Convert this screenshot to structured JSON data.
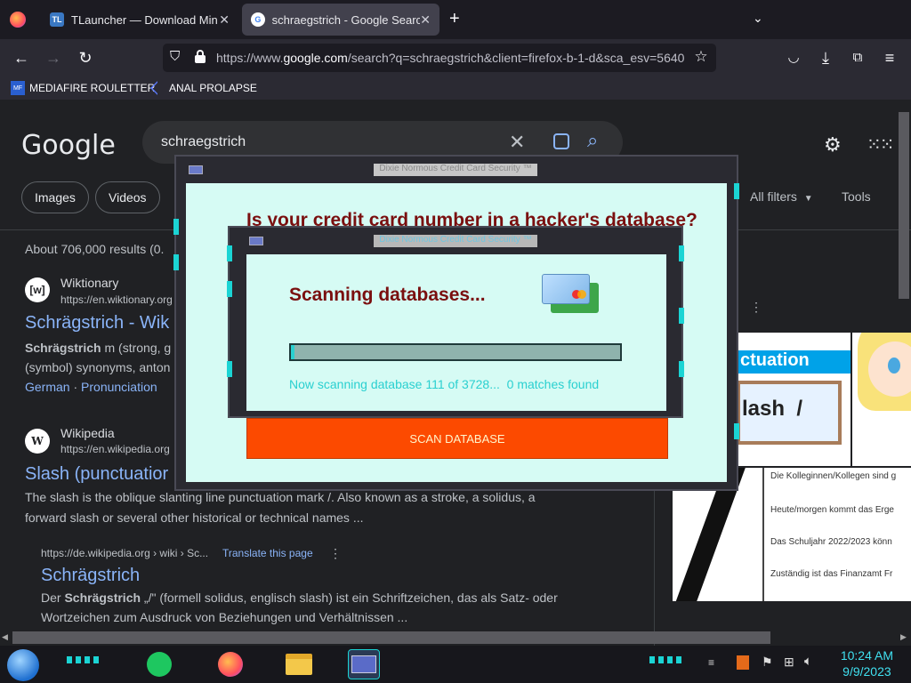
{
  "browser": {
    "tabs": [
      {
        "favicon": "TL",
        "title": "TLauncher — Download Minec"
      },
      {
        "favicon": "G",
        "title": "schraegstrich - Google Search"
      }
    ],
    "new_tab": "+",
    "url_prefix": "https://www.",
    "url_domain": "google.com",
    "url_rest": "/search?q=schraegstrich&client=firefox-b-1-d&sca_esv=5640",
    "bookmarks": [
      {
        "icon": "MF",
        "label": "MEDIAFIRE ROULETTER"
      },
      {
        "icon": "flag",
        "label": "ANAL PROLAPSE"
      }
    ]
  },
  "google": {
    "logo": "Google",
    "query": "schraegstrich",
    "chips": [
      "Images",
      "Videos"
    ],
    "all_filters": "All filters",
    "tools": "Tools",
    "stats": "About 706,000 results (0.",
    "results": [
      {
        "favicon": "[w]",
        "site": "Wiktionary",
        "url": "https://en.wiktionary.org",
        "title": "Schrägstrich - Wik",
        "snippet_bold": "Schrägstrich",
        "snippet1": " m (strong, g",
        "snippet2": "(symbol) synonyms, anton",
        "links": [
          "German",
          "Pronunciation"
        ]
      },
      {
        "favicon": "W",
        "site": "Wikipedia",
        "url": "https://en.wikipedia.org",
        "title": "Slash (punctuatior",
        "snippet1": "The slash is the oblique slanting line punctuation mark /. Also known as a stroke, a solidus, a",
        "snippet2": "forward slash or several other historical or technical names ..."
      },
      {
        "url": "https://de.wikipedia.org › wiki › Sc...",
        "translate": "Translate this page",
        "title": "Schrägstrich",
        "snippet_pre": "Der ",
        "snippet_bold": "Schrägstrich",
        "snippet1": " „/\" (formell solidus, englisch slash) ist ein Schriftzeichen, das als Satz- oder",
        "snippet2": "Wortzeichen zum Ausdruck von Beziehungen und Verhältnissen ..."
      }
    ],
    "side_panel": {
      "banner": "ctuation",
      "box_text": "lash  /",
      "lines": [
        "Die Kolleginnen/Kollegen sind g",
        "Heute/morgen kommt das Erge",
        "Das Schuljahr 2022/2023 könn",
        "Zuständig ist das Finanzamt Fr"
      ]
    }
  },
  "popup_back": {
    "title": "Dixie Normous Credit Card Security ™",
    "headline": "Is your credit card number in a hacker's database?",
    "button": "SCAN DATABASE"
  },
  "popup_front": {
    "title": "Dixie Normous Credit Card Security ™",
    "heading": "Scanning databases...",
    "progress": 0.01,
    "status": "Now scanning database 111 of 3728...  0 matches found"
  },
  "taskbar": {
    "time": "10:24 AM",
    "date": "9/9/2023"
  },
  "colors": {
    "popup_bg": "#d6fbf4",
    "headline": "#7a0f0f",
    "accent_cyan": "#1bd4d4",
    "button_orange": "#fc4a00",
    "link_blue": "#8ab4f8"
  }
}
